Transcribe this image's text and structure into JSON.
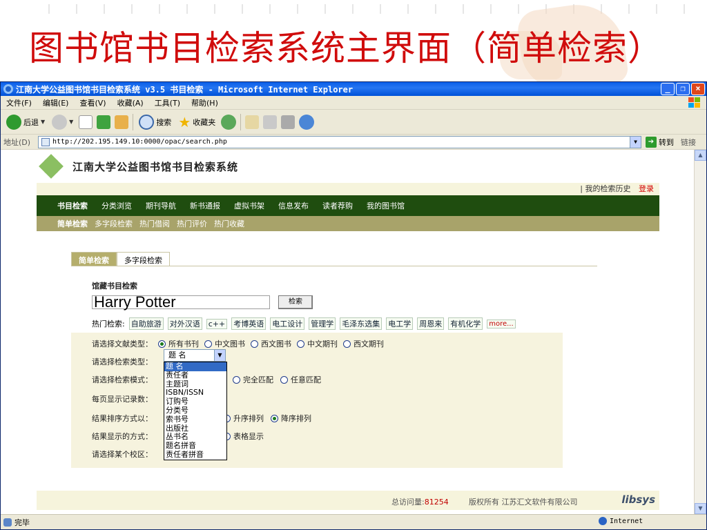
{
  "slide": {
    "title": "图书馆书目检索系统主界面（简单检索）"
  },
  "window": {
    "title": "江南大学公益图书馆书目检索系统 v3.5 书目检索 - Microsoft Internet Explorer",
    "controls": [
      "_",
      "❐",
      "×"
    ]
  },
  "menubar": {
    "items": [
      "文件(F)",
      "编辑(E)",
      "查看(V)",
      "收藏(A)",
      "工具(T)",
      "帮助(H)"
    ]
  },
  "toolbar": {
    "back_label": "后退",
    "search_label": "搜索",
    "favorites_label": "收藏夹"
  },
  "addressbar": {
    "label": "地址(D)",
    "url": "http://202.195.149.10:0000/opac/search.php",
    "go_label": "转到",
    "links_label": "链接"
  },
  "site": {
    "title": "江南大学公益图书馆书目检索系统",
    "history_link": "我的检索历史",
    "login_link": "登录",
    "mainnav": [
      "书目检索",
      "分类浏览",
      "期刊导航",
      "新书通报",
      "虚拟书架",
      "信息发布",
      "读者荐购",
      "我的图书馆"
    ],
    "subnav": [
      "简单检索",
      "多字段检索",
      "热门借阅",
      "热门评价",
      "热门收藏"
    ]
  },
  "search": {
    "tabs": [
      "简单检索",
      "多字段检索"
    ],
    "heading": "馆藏书目检索",
    "query": "Harry Potter",
    "button_label": "检索",
    "hot_label": "热门检索:",
    "hot_terms": [
      "自助旅游",
      "对外汉语",
      "c++",
      "考博英语",
      "电工设计",
      "管理学",
      "毛泽东选集",
      "电工学",
      "周恩来",
      "有机化学"
    ],
    "more_label": "more..."
  },
  "options": {
    "doc_type_label": "请选择文献类型：",
    "doc_types": [
      "所有书刊",
      "中文图书",
      "西文图书",
      "中文期刊",
      "西文期刊"
    ],
    "doc_type_selected": "所有书刊",
    "search_type_label": "请选择检索类型：",
    "search_type_selected": "题 名",
    "search_type_options": [
      "题 名",
      "责任者",
      "主题词",
      "ISBN/ISSN",
      "订购号",
      "分类号",
      "索书号",
      "出版社",
      "丛书名",
      "题名拼音",
      "责任者拼音"
    ],
    "mode_label": "请选择检索模式：",
    "mode_options_visible": [
      "完全匹配",
      "任意匹配"
    ],
    "per_page_label": "每页显示记录数：",
    "sort_label": "结果排序方式以：",
    "sort_options": [
      "升序排列",
      "降序排列"
    ],
    "sort_selected": "降序排列",
    "display_label": "结果显示的方式：",
    "display_option_visible": "表格显示",
    "campus_label": "请选择某个校区："
  },
  "footer": {
    "visits_label": "总访问量:",
    "visits_value": "81254",
    "copyright": "版权所有 江苏汇文软件有限公司",
    "brand": "libsys"
  },
  "statusbar": {
    "status_text": "完毕",
    "zone_text": "Internet"
  },
  "colors": {
    "slide_title": "#d00c0c",
    "nav_green": "#1f4d0f",
    "subnav_olive": "#a8a36a",
    "titlebar_blue": "#0a5ee8"
  }
}
